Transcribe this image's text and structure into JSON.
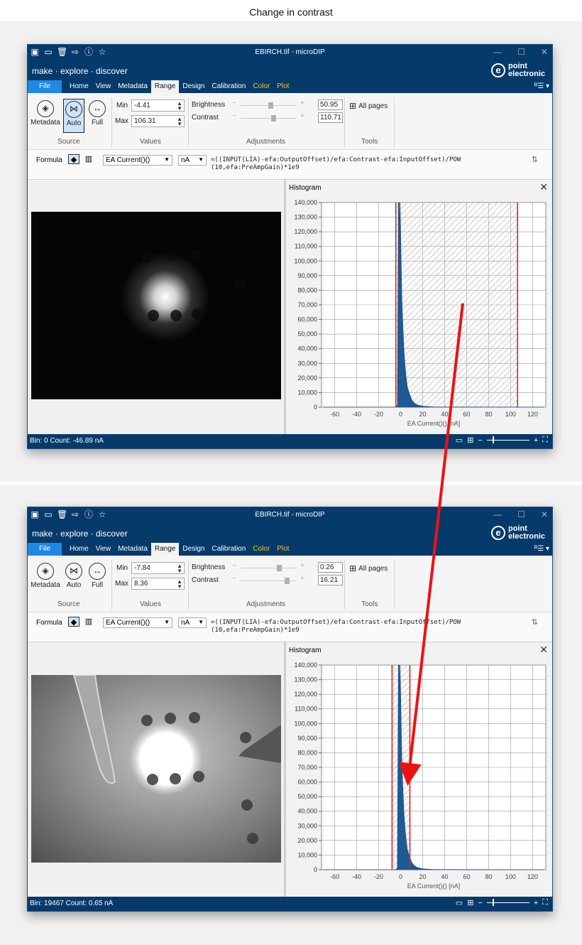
{
  "caption": "Change in contrast",
  "app": {
    "title": "EBIRCH.tif - microDIP",
    "tagline": "make · explore · discover",
    "brand": [
      "point",
      "electronic"
    ],
    "menu": [
      {
        "label": "File",
        "kind": "file"
      },
      {
        "label": "Home",
        "kind": "normal"
      },
      {
        "label": "View",
        "kind": "normal"
      },
      {
        "label": "Metadata",
        "kind": "normal"
      },
      {
        "label": "Range",
        "kind": "active"
      },
      {
        "label": "Design",
        "kind": "normal"
      },
      {
        "label": "Calibration",
        "kind": "normal"
      },
      {
        "label": "Color",
        "kind": "accent"
      },
      {
        "label": "Plot",
        "kind": "accent"
      }
    ],
    "ribbon": {
      "source_buttons": [
        "Metadata",
        "Auto",
        "Full"
      ],
      "groups": [
        "Source",
        "Values",
        "Adjustments",
        "Tools"
      ],
      "min_label": "Min",
      "max_label": "Max",
      "brightness_label": "Brightness",
      "contrast_label": "Contrast",
      "all_pages": "All pages"
    },
    "formula": {
      "label": "Formula",
      "channel": "EA Current()()",
      "unit": "nA",
      "expr_line1": "=((INPUT(LIA)-efa:OutputOffset)/efa:Contrast-efa:InputOffset)/POW",
      "expr_line2": "(10,efa:PreAmpGain)*1e9"
    },
    "histogram_title": "Histogram"
  },
  "windows": [
    {
      "auto_selected": true,
      "min": "-4.41",
      "max": "106.31",
      "brightness": "50.95",
      "contrast": "110.71",
      "brightness_level": 0.5,
      "contrast_level": 0.55,
      "status": "Bin: 0  Count: -46.89 nA",
      "image": "dark",
      "range_min": -4.41,
      "range_max": 106.31
    },
    {
      "auto_selected": false,
      "min": "-7.84",
      "max": "8.36",
      "brightness": "0.26",
      "contrast": "16.21",
      "brightness_level": 0.66,
      "contrast_level": 0.8,
      "status": "Bin: 19467  Count: 0.65 nA",
      "image": "bright",
      "range_min": -7.84,
      "range_max": 8.36
    }
  ],
  "chart_data": [
    {
      "type": "area",
      "title": "Histogram",
      "xlabel": "EA Current()() [nA]",
      "ylabel": "",
      "xlim": [
        -72,
        132
      ],
      "ylim": [
        0,
        140000
      ],
      "xticks": [
        -60,
        -40,
        -20,
        0,
        20,
        40,
        60,
        80,
        100,
        120
      ],
      "yticks": [
        0,
        10000,
        20000,
        30000,
        40000,
        50000,
        60000,
        70000,
        80000,
        90000,
        100000,
        110000,
        120000,
        130000,
        140000
      ],
      "ytick_labels": [
        "0",
        "10,000",
        "20,000",
        "30,000",
        "40,000",
        "50,000",
        "60,000",
        "70,000",
        "80,000",
        "90,000",
        "100,000",
        "110,000",
        "120,000",
        "130,000",
        "140,000"
      ],
      "grid": true,
      "x": [
        -70,
        -5,
        -3,
        -2,
        -1,
        0,
        1,
        2,
        3,
        4,
        5,
        6,
        8,
        10,
        12,
        15,
        20,
        30,
        130
      ],
      "y": [
        0,
        0,
        1000,
        140000,
        140000,
        118000,
        75000,
        55000,
        38000,
        28000,
        20000,
        14000,
        9000,
        5000,
        3000,
        1500,
        600,
        100,
        0
      ],
      "range_min": -4.41,
      "range_max": 106.31
    },
    {
      "type": "area",
      "title": "Histogram",
      "xlabel": "EA Current()() [nA]",
      "ylabel": "",
      "xlim": [
        -72,
        132
      ],
      "ylim": [
        0,
        140000
      ],
      "xticks": [
        -60,
        -40,
        -20,
        0,
        20,
        40,
        60,
        80,
        100,
        120
      ],
      "yticks": [
        0,
        10000,
        20000,
        30000,
        40000,
        50000,
        60000,
        70000,
        80000,
        90000,
        100000,
        110000,
        120000,
        130000,
        140000
      ],
      "ytick_labels": [
        "0",
        "10,000",
        "20,000",
        "30,000",
        "40,000",
        "50,000",
        "60,000",
        "70,000",
        "80,000",
        "90,000",
        "100,000",
        "110,000",
        "120,000",
        "130,000",
        "140,000"
      ],
      "grid": true,
      "x": [
        -70,
        -5,
        -3,
        -2,
        -1,
        0,
        1,
        2,
        3,
        4,
        5,
        6,
        8,
        10,
        12,
        15,
        20,
        30,
        130
      ],
      "y": [
        0,
        0,
        1000,
        140000,
        140000,
        118000,
        75000,
        55000,
        38000,
        28000,
        20000,
        14000,
        9000,
        5000,
        3000,
        1500,
        600,
        100,
        0
      ],
      "range_min": -7.84,
      "range_max": 8.36
    }
  ],
  "colors": {
    "navy": "#063a6b",
    "file_blue": "#1e88e5",
    "accent_yellow": "#f5c518",
    "range_line": "#e02020",
    "histogram_fill": "#1f5a94",
    "annotation_arrow": "#ee1111"
  }
}
